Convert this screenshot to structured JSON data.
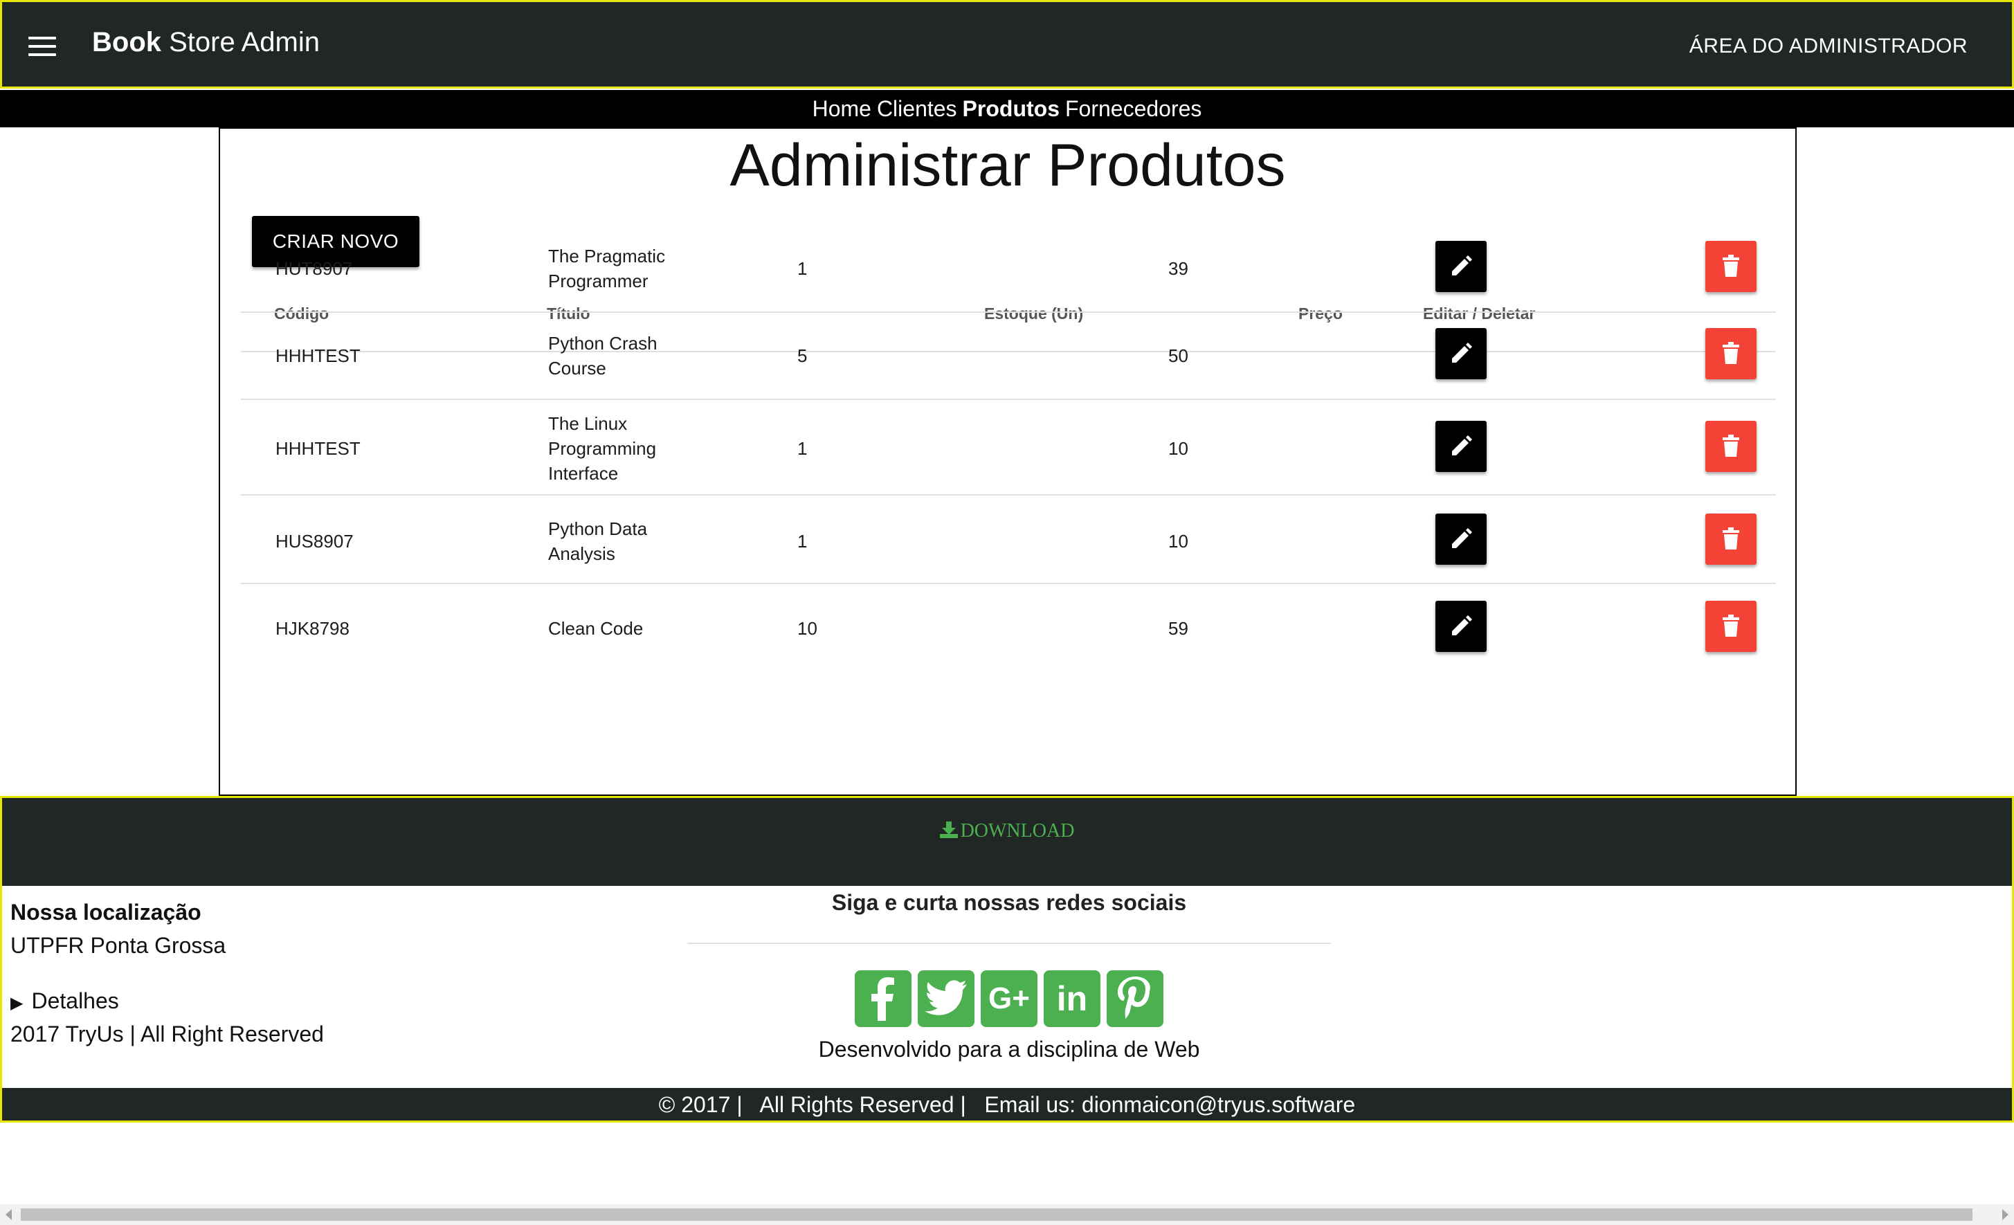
{
  "header": {
    "brand_bold": "Book",
    "brand_rest": " Store Admin",
    "admin_link": "ÁREA DO ADMINISTRADOR",
    "menu_icon": "hamburger-icon"
  },
  "nav": {
    "items": [
      {
        "label": "Home",
        "active": false
      },
      {
        "label": "Clientes",
        "active": false
      },
      {
        "label": "Produtos",
        "active": true
      },
      {
        "label": "Fornecedores",
        "active": false
      }
    ]
  },
  "main": {
    "title": "Administrar Produtos",
    "create_button": "CRIAR NOVO",
    "columns": {
      "code": "Código",
      "title": "Título",
      "stock": "Estoque (Un)",
      "price": "Preço",
      "actions": "Editar / Deletar"
    },
    "rows": [
      {
        "code": "HUT8907",
        "title_lines": [
          "The Pragmatic",
          "Programmer"
        ],
        "stock": "1",
        "price": "39"
      },
      {
        "code": "HHHTEST",
        "title_lines": [
          "Python Crash",
          "Course"
        ],
        "stock": "5",
        "price": "50"
      },
      {
        "code": "HHHTEST",
        "title_lines": [
          "The Linux",
          "Programming",
          "Interface"
        ],
        "stock": "1",
        "price": "10"
      },
      {
        "code": "HUS8907",
        "title_lines": [
          "Python Data",
          "Analysis"
        ],
        "stock": "1",
        "price": "10"
      },
      {
        "code": "HJK8798",
        "title_lines": [
          "Clean Code"
        ],
        "stock": "10",
        "price": "59"
      }
    ],
    "edit_icon": "pencil-icon",
    "delete_icon": "trash-icon"
  },
  "footer": {
    "download_label": "DOWNLOAD",
    "download_icon": "download-icon",
    "location_title": "Nossa localização",
    "location_name": "UTPFR Ponta Grossa",
    "details_label": "Detalhes",
    "rights": "2017 TryUs | All Right Reserved",
    "social_title": "Siga e curta nossas redes sociais",
    "social_icons": [
      "facebook-icon",
      "twitter-icon",
      "google-plus-icon",
      "linkedin-icon",
      "pinterest-icon"
    ],
    "dev_note": "Desenvolvido para a disciplina de Web",
    "bottom_line": "© 2017 |   All Rights Reserved |   Email us: dionmaicon@tryus.software"
  },
  "colors": {
    "header_bg": "#212724",
    "header_border": "#e6e600",
    "delete_red": "#f44336",
    "download_green": "#4caf50"
  }
}
